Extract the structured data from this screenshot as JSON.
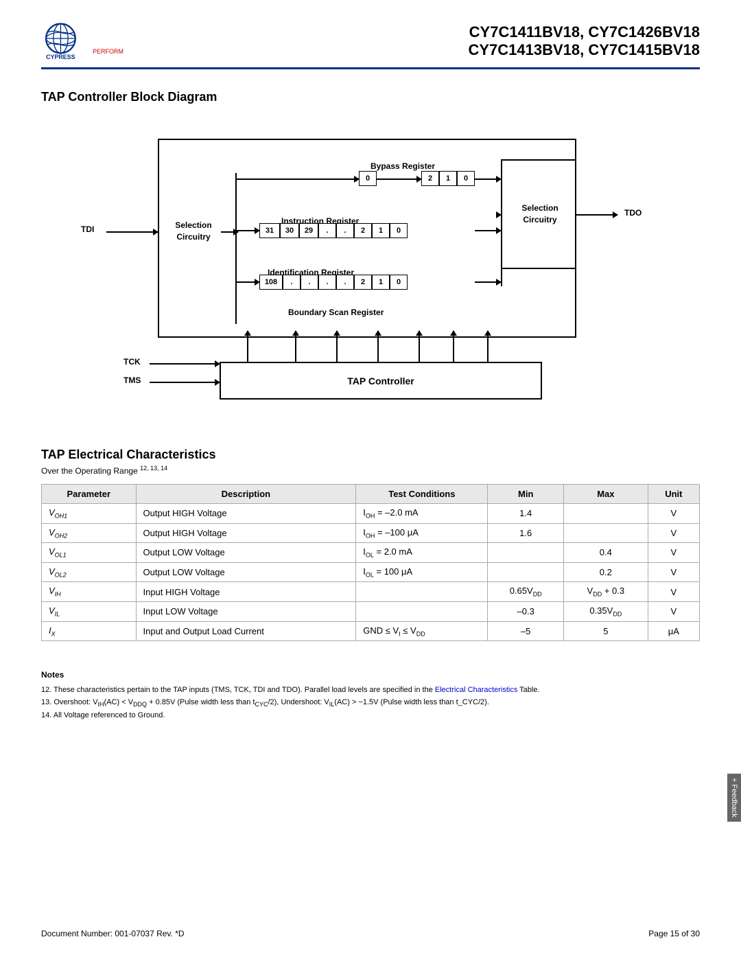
{
  "header": {
    "title_line1": "CY7C1411BV18, CY7C1426BV18",
    "title_line2": "CY7C1413BV18, CY7C1415BV18"
  },
  "diagram_section": {
    "title": "TAP Controller Block Diagram"
  },
  "diagram": {
    "tdi_label": "TDI",
    "tdo_label": "TDO",
    "tck_label": "TCK",
    "tms_label": "TMS",
    "selection_circuitry_left": "Selection\nCircuitry",
    "selection_circuitry_right": "Selection\nCircuitry",
    "bypass_register_label": "Bypass Register",
    "instruction_register_label": "Instruction Register",
    "identification_register_label": "Identification Register",
    "boundary_scan_label": "Boundary Scan Register",
    "tap_controller_label": "TAP Controller",
    "bypass_cells": [
      "2",
      "1",
      "0"
    ],
    "bypass_single": "0",
    "instruction_cells": [
      "31",
      "30",
      "29",
      ".",
      ".",
      "2",
      "1",
      "0"
    ],
    "identification_cells": [
      "108",
      ".",
      ".",
      ".",
      ".",
      "2",
      "1",
      "0"
    ]
  },
  "tap_section": {
    "title": "TAP Electrical Characteristics",
    "subtitle": "Over the Operating Range",
    "subtitle_sup": "12, 13, 14",
    "table": {
      "headers": [
        "Parameter",
        "Description",
        "Test Conditions",
        "Min",
        "Max",
        "Unit"
      ],
      "rows": [
        {
          "param": "V_OH1",
          "param_sub": "OH1",
          "param_pre": "V",
          "description": "Output HIGH Voltage",
          "test_conditions": "I_OH = –2.0 mA",
          "min": "1.4",
          "max": "",
          "unit": "V"
        },
        {
          "param": "V_OH2",
          "param_sub": "OH2",
          "param_pre": "V",
          "description": "Output HIGH Voltage",
          "test_conditions": "I_OH = –100 μA",
          "min": "1.6",
          "max": "",
          "unit": "V"
        },
        {
          "param": "V_OL1",
          "param_sub": "OL1",
          "param_pre": "V",
          "description": "Output LOW Voltage",
          "test_conditions": "I_OL = 2.0 mA",
          "min": "",
          "max": "0.4",
          "unit": "V"
        },
        {
          "param": "V_OL2",
          "param_sub": "OL2",
          "param_pre": "V",
          "description": "Output LOW Voltage",
          "test_conditions": "I_OL = 100 μA",
          "min": "",
          "max": "0.2",
          "unit": "V"
        },
        {
          "param": "V_IH",
          "param_sub": "IH",
          "param_pre": "V",
          "description": "Input HIGH Voltage",
          "test_conditions": "",
          "min": "0.65V_DD",
          "max": "V_DD + 0.3",
          "unit": "V"
        },
        {
          "param": "V_IL",
          "param_sub": "IL",
          "param_pre": "V",
          "description": "Input LOW Voltage",
          "test_conditions": "",
          "min": "–0.3",
          "max": "0.35V_DD",
          "unit": "V"
        },
        {
          "param": "I_X",
          "param_sub": "X",
          "param_pre": "I",
          "description": "Input and Output Load Current",
          "test_conditions": "GND ≤ V_I ≤ V_DD",
          "min": "–5",
          "max": "5",
          "unit": "μA"
        }
      ]
    }
  },
  "notes": {
    "title": "Notes",
    "items": [
      "12. These characteristics pertain to the TAP inputs (TMS, TCK, TDI and TDO). Parallel load levels are specified in the Electrical Characteristics Table.",
      "13. Overshoot: V_IH(AC) < V_DDQ + 0.85V (Pulse width less than t_CYC/2), Undershoot: V_IL(AC) > −1.5V (Pulse width less than t_CYC/2).",
      "14. All Voltage referenced to Ground."
    ]
  },
  "footer": {
    "doc_number": "Document Number: 001-07037 Rev. *D",
    "page_info": "Page 15 of 30"
  },
  "feedback": {
    "label": "+ Feedback"
  }
}
